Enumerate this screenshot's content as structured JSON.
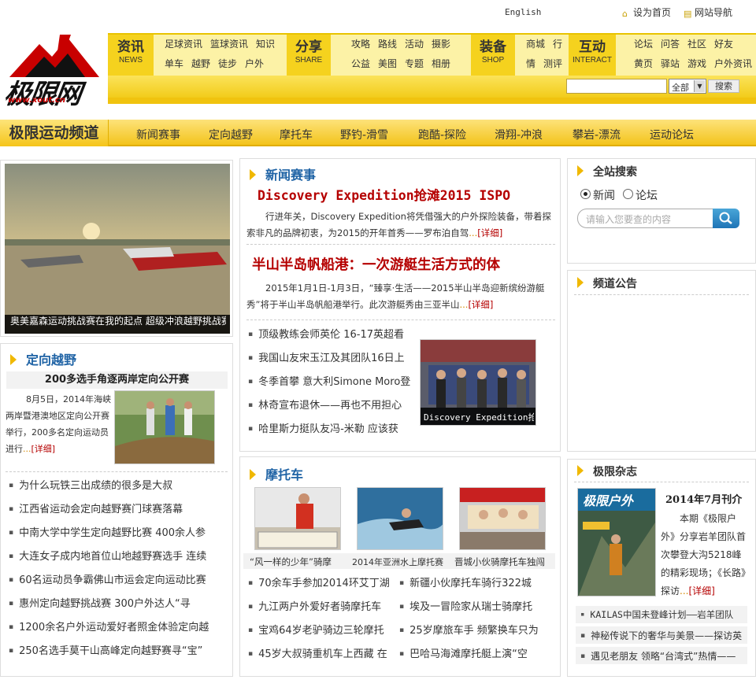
{
  "topbar": {
    "english": "English",
    "set_home": "设为首页",
    "site_nav": "网站导航"
  },
  "logo": {
    "brand": "极限网",
    "url": "www.xout.cn"
  },
  "nav": {
    "news": {
      "cn": "资讯",
      "en": "NEWS",
      "row1": [
        "足球资讯",
        "篮球资讯",
        "知识"
      ],
      "row2": [
        "单车",
        "越野",
        "徒步",
        "户外"
      ]
    },
    "share": {
      "cn": "分享",
      "en": "SHARE",
      "row1": [
        "攻略",
        "路线",
        "活动",
        "摄影"
      ],
      "row2": [
        "公益",
        "美图",
        "专题",
        "相册"
      ]
    },
    "shop": {
      "cn": "装备",
      "en": "SHOP",
      "row1": [
        "商城",
        "行"
      ],
      "row2": [
        "情",
        "测评"
      ]
    },
    "interact": {
      "cn": "互动",
      "en": "INTERACT",
      "row1": [
        "论坛",
        "问答",
        "社区",
        "好友"
      ],
      "row2": [
        "黄页",
        "驿站",
        "游戏",
        "户外资讯"
      ]
    }
  },
  "search_bar": {
    "select_value": "全部",
    "button": "搜索"
  },
  "channel": {
    "title": "极限运动频道",
    "items": [
      "新闻赛事",
      "定向越野",
      "摩托车",
      "野钓-滑雪",
      "跑酷-探险",
      "滑翔-冲浪",
      "攀岩-漂流",
      "运动论坛"
    ]
  },
  "hero": {
    "caption": "奥美嘉森运动挑战赛在我的起点 超级冲浪越野挑战赛举行"
  },
  "orienteering": {
    "heading": "定向越野",
    "feature_title": "200多选手角逐两岸定向公开赛",
    "feature_text": "8月5日，2014年海峡两岸暨港澳地区定向公开赛举行，200多名定向运动员进行",
    "detail": "[详细]",
    "list": [
      "为什么玩铁三出成绩的很多是大叔",
      "江西省运动会定向越野赛门球赛落幕",
      "中南大学中学生定向越野比赛 400余人参",
      "大连女子成内地首位山地越野赛选手 连续",
      "60名运动员争霸佛山市运会定向运动比赛",
      "惠州定向越野挑战赛 300户外达人“寻",
      "1200余名户外运动爱好者照金体验定向越",
      "250名选手莫干山高峰定向越野赛寻“宝”"
    ]
  },
  "news": {
    "heading": "新闻赛事",
    "headline1": "Discovery Expedition抢滩2015 ISPO",
    "summary1": "行进年关，Discovery Expedition将凭借强大的户外探险装备，带着探索非凡的品牌初衷，为2015的开年首秀——罗布泊自驾",
    "headline2": "半山半岛帆船港：一次游艇生活方式的体",
    "summary2": "2015年1月1日-1月3日，“臻享·生活——2015半山半岛迎新缤纷游艇秀”将于半山半岛帆船港举行。此次游艇秀由三亚半山",
    "detail": "[详细]",
    "list": [
      "顶级教练会师英伦 16-17英超看",
      "我国山友宋玉江及其团队16日上",
      "冬季首攀 意大利Simone Moro登",
      "林奇宣布退休——再也不用担心",
      "哈里斯力挺队友冯-米勒 应该获"
    ],
    "photo_caption": "Discovery Expedition抢"
  },
  "moto": {
    "heading": "摩托车",
    "captions": [
      "“风一样的少年”骑摩",
      "2014年亚洲水上摩托赛",
      "晋城小伙骑摩托车独闯"
    ],
    "left_list": [
      "70余车手参加2014环艾丁湖",
      "九江两户外爱好者骑摩托车",
      "宝鸡64岁老驴骑边三轮摩托",
      "45岁大叔骑重机车上西藏 在"
    ],
    "right_list": [
      "新疆小伙摩托车骑行322城",
      "埃及一冒险家从瑞士骑摩托",
      "25岁摩旅车手 频繁换车只为",
      "巴哈马海滩摩托艇上演“空"
    ]
  },
  "site_search": {
    "heading": "全站搜索",
    "options": [
      "新闻",
      "论坛"
    ],
    "placeholder": "请输入您要查的内容"
  },
  "notice": {
    "heading": "频道公告"
  },
  "magazine": {
    "heading": "极限杂志",
    "issue": "2014年7月刊介",
    "cover_title": "极限户外",
    "text": "本期《极限户外》分享岩羊团队首次攀登大沟5218峰的精彩现场；《长路》探访",
    "detail": "[详细]",
    "list": [
      "KAILAS中国未登峰计划——岩羊团队",
      "神秘传说下的奢华与美景——探访英",
      "遇见老朋友 领略“台湾式”热情——"
    ]
  },
  "colors": {
    "accent_yellow": "#f5d21e",
    "link_blue": "#1f63a5",
    "headline_red": "#b50000"
  }
}
